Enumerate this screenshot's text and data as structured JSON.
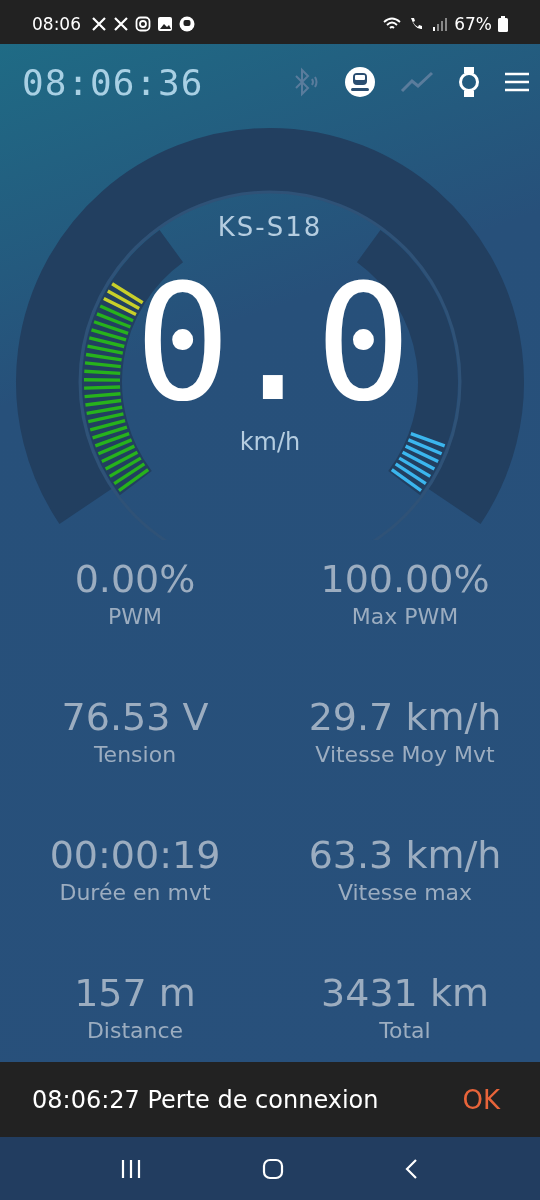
{
  "status_bar": {
    "time": "08:06",
    "battery": "67%"
  },
  "header": {
    "clock": "08:06:36"
  },
  "gauge": {
    "model": "KS-S18",
    "speed": "0.0",
    "unit": "km/h"
  },
  "stats": [
    {
      "value": "0.00%",
      "label": "PWM"
    },
    {
      "value": "100.00%",
      "label": "Max PWM"
    },
    {
      "value": "76.53 V",
      "label": "Tension"
    },
    {
      "value": "29.7 km/h",
      "label": "Vitesse Moy Mvt"
    },
    {
      "value": "00:00:19",
      "label": "Durée en mvt"
    },
    {
      "value": "63.3 km/h",
      "label": "Vitesse max"
    },
    {
      "value": "157 m",
      "label": "Distance"
    },
    {
      "value": "3431 km",
      "label": "Total"
    }
  ],
  "snackbar": {
    "message": "08:06:27 Perte de connexion",
    "action": "OK"
  }
}
